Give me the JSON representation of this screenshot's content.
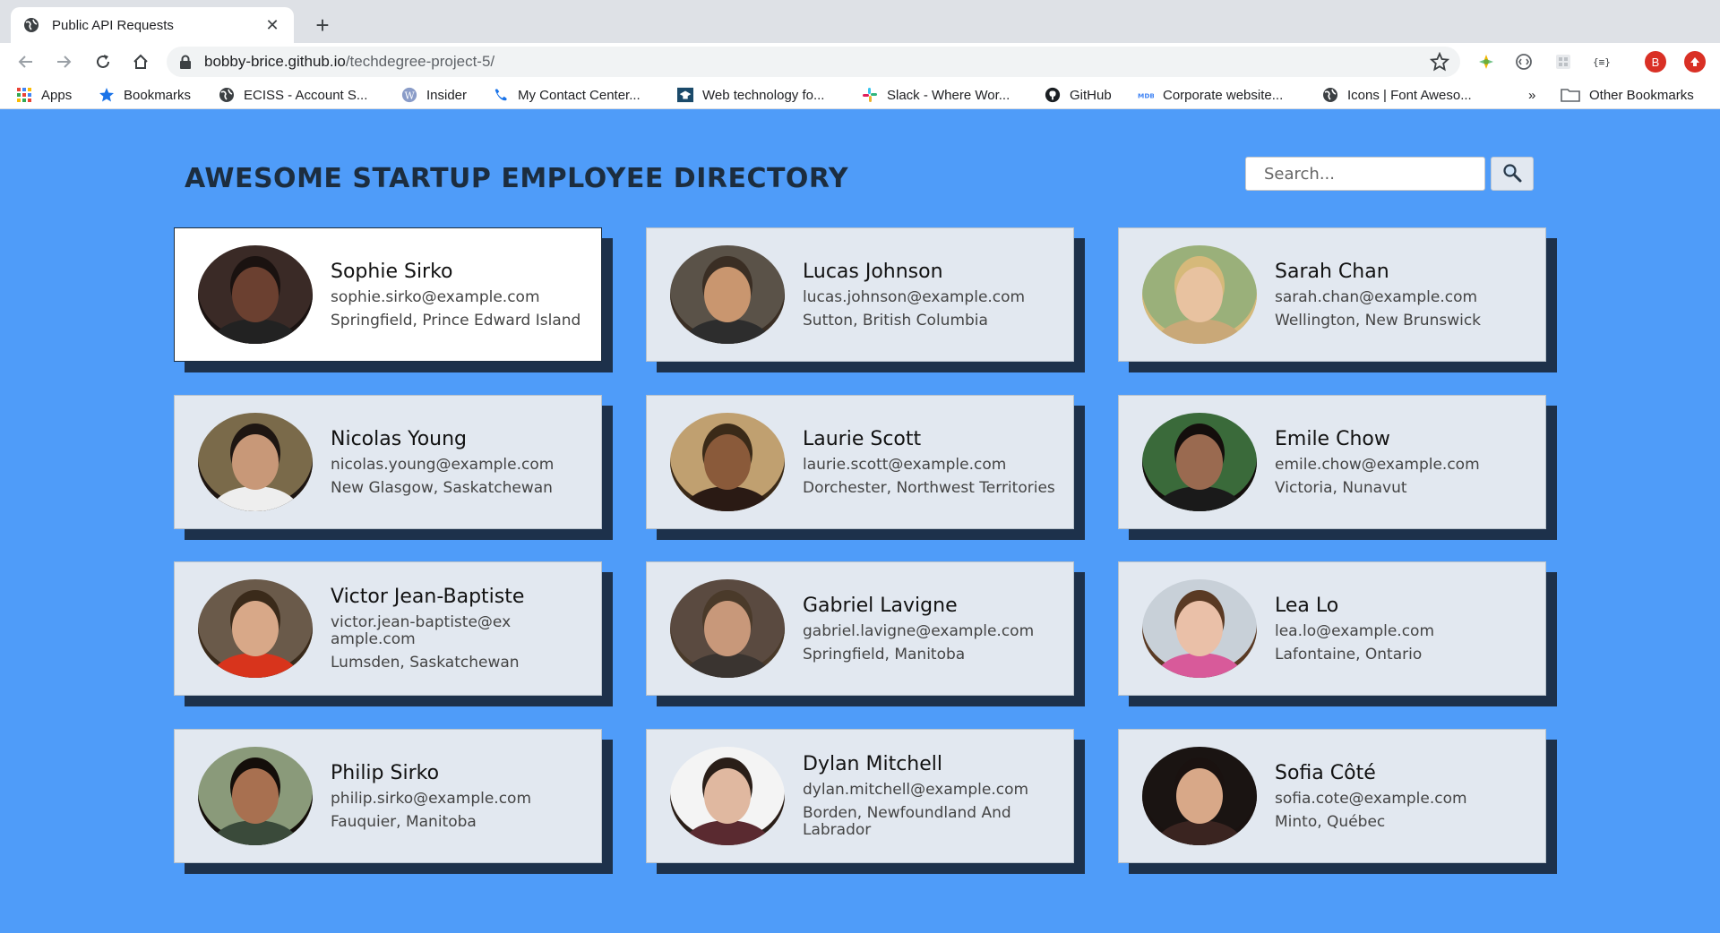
{
  "browser": {
    "tab_title": "Public API Requests",
    "url_host": "bobby-brice.github.io",
    "url_path": "/techdegree-project-5/",
    "profile_initial": "B"
  },
  "bookmarks": [
    {
      "label": "Apps",
      "icon": "apps-grid-icon"
    },
    {
      "label": "Bookmarks",
      "icon": "star-icon"
    },
    {
      "label": "ECISS - Account S...",
      "icon": "globe-icon"
    },
    {
      "label": "Insider",
      "icon": "wordpress-icon"
    },
    {
      "label": "My Contact Center...",
      "icon": "phone-icon"
    },
    {
      "label": "Web technology fo...",
      "icon": "mortarboard-icon"
    },
    {
      "label": "Slack - Where Wor...",
      "icon": "slack-icon"
    },
    {
      "label": "GitHub",
      "icon": "github-icon"
    },
    {
      "label": "Corporate website...",
      "icon": "mdb-icon"
    },
    {
      "label": "Icons | Font Aweso...",
      "icon": "globe-icon"
    },
    {
      "label": "»",
      "icon": ""
    },
    {
      "label": "Other Bookmarks",
      "icon": "folder-icon"
    }
  ],
  "header": {
    "title": "AWESOME STARTUP EMPLOYEE DIRECTORY",
    "search_placeholder": "Search..."
  },
  "employees": [
    {
      "name": "Sophie Sirko",
      "email": "sophie.sirko@example.com",
      "location": "Springfield, Prince Edward Island",
      "skin": "#6b4030",
      "hair": "#1a1210",
      "shirt": "#222222",
      "bg": "#3a2a26"
    },
    {
      "name": "Lucas Johnson",
      "email": "lucas.johnson@example.com",
      "location": "Sutton, British Columbia",
      "skin": "#c9966f",
      "hair": "#3a2e24",
      "shirt": "#2d2d2d",
      "bg": "#5a5248"
    },
    {
      "name": "Sarah Chan",
      "email": "sarah.chan@example.com",
      "location": "Wellington, New Brunswick",
      "skin": "#e8c2a0",
      "hair": "#d6b97a",
      "shirt": "#c9a878",
      "bg": "#9ab07a"
    },
    {
      "name": "Nicolas Young",
      "email": "nicolas.young@example.com",
      "location": "New Glasgow, Saskatchewan",
      "skin": "#c89878",
      "hair": "#1e1612",
      "shirt": "#eeeeee",
      "bg": "#7a6a4a"
    },
    {
      "name": "Laurie Scott",
      "email": "laurie.scott@example.com",
      "location": "Dorchester, Northwest Territories",
      "skin": "#8a5a3a",
      "hair": "#3a2a18",
      "shirt": "#2a1a14",
      "bg": "#c0a070"
    },
    {
      "name": "Emile Chow",
      "email": "emile.chow@example.com",
      "location": "Victoria, Nunavut",
      "skin": "#9a6a50",
      "hair": "#140e0c",
      "shirt": "#1a1a1a",
      "bg": "#3a6a3a"
    },
    {
      "name": "Victor Jean-Baptiste",
      "email": "victor.jean-baptiste@example.com",
      "location": "Lumsden, Saskatchewan",
      "skin": "#d8a888",
      "hair": "#3a2a1a",
      "shirt": "#d8341c",
      "bg": "#6a5a4a"
    },
    {
      "name": "Gabriel Lavigne",
      "email": "gabriel.lavigne@example.com",
      "location": "Springfield, Manitoba",
      "skin": "#c8987a",
      "hair": "#4a3a2a",
      "shirt": "#3a3430",
      "bg": "#5a4a40"
    },
    {
      "name": "Lea Lo",
      "email": "lea.lo@example.com",
      "location": "Lafontaine, Ontario",
      "skin": "#eac0a8",
      "hair": "#5a3a24",
      "shirt": "#d85a9a",
      "bg": "#c8d0d8"
    },
    {
      "name": "Philip Sirko",
      "email": "philip.sirko@example.com",
      "location": "Fauquier, Manitoba",
      "skin": "#a87050",
      "hair": "#140e0a",
      "shirt": "#3a4a3a",
      "bg": "#8a9a7a"
    },
    {
      "name": "Dylan Mitchell",
      "email": "dylan.mitchell@example.com",
      "location": "Borden, Newfoundland And Labrador",
      "skin": "#e0b8a0",
      "hair": "#2a1e18",
      "shirt": "#5a2a30",
      "bg": "#f4f4f4"
    },
    {
      "name": "Sofia Côté",
      "email": "sofia.cote@example.com",
      "location": "Minto, Québec",
      "skin": "#d8a888",
      "hair": "#1a1210",
      "shirt": "#3a2420",
      "bg": "#1a1412"
    }
  ]
}
